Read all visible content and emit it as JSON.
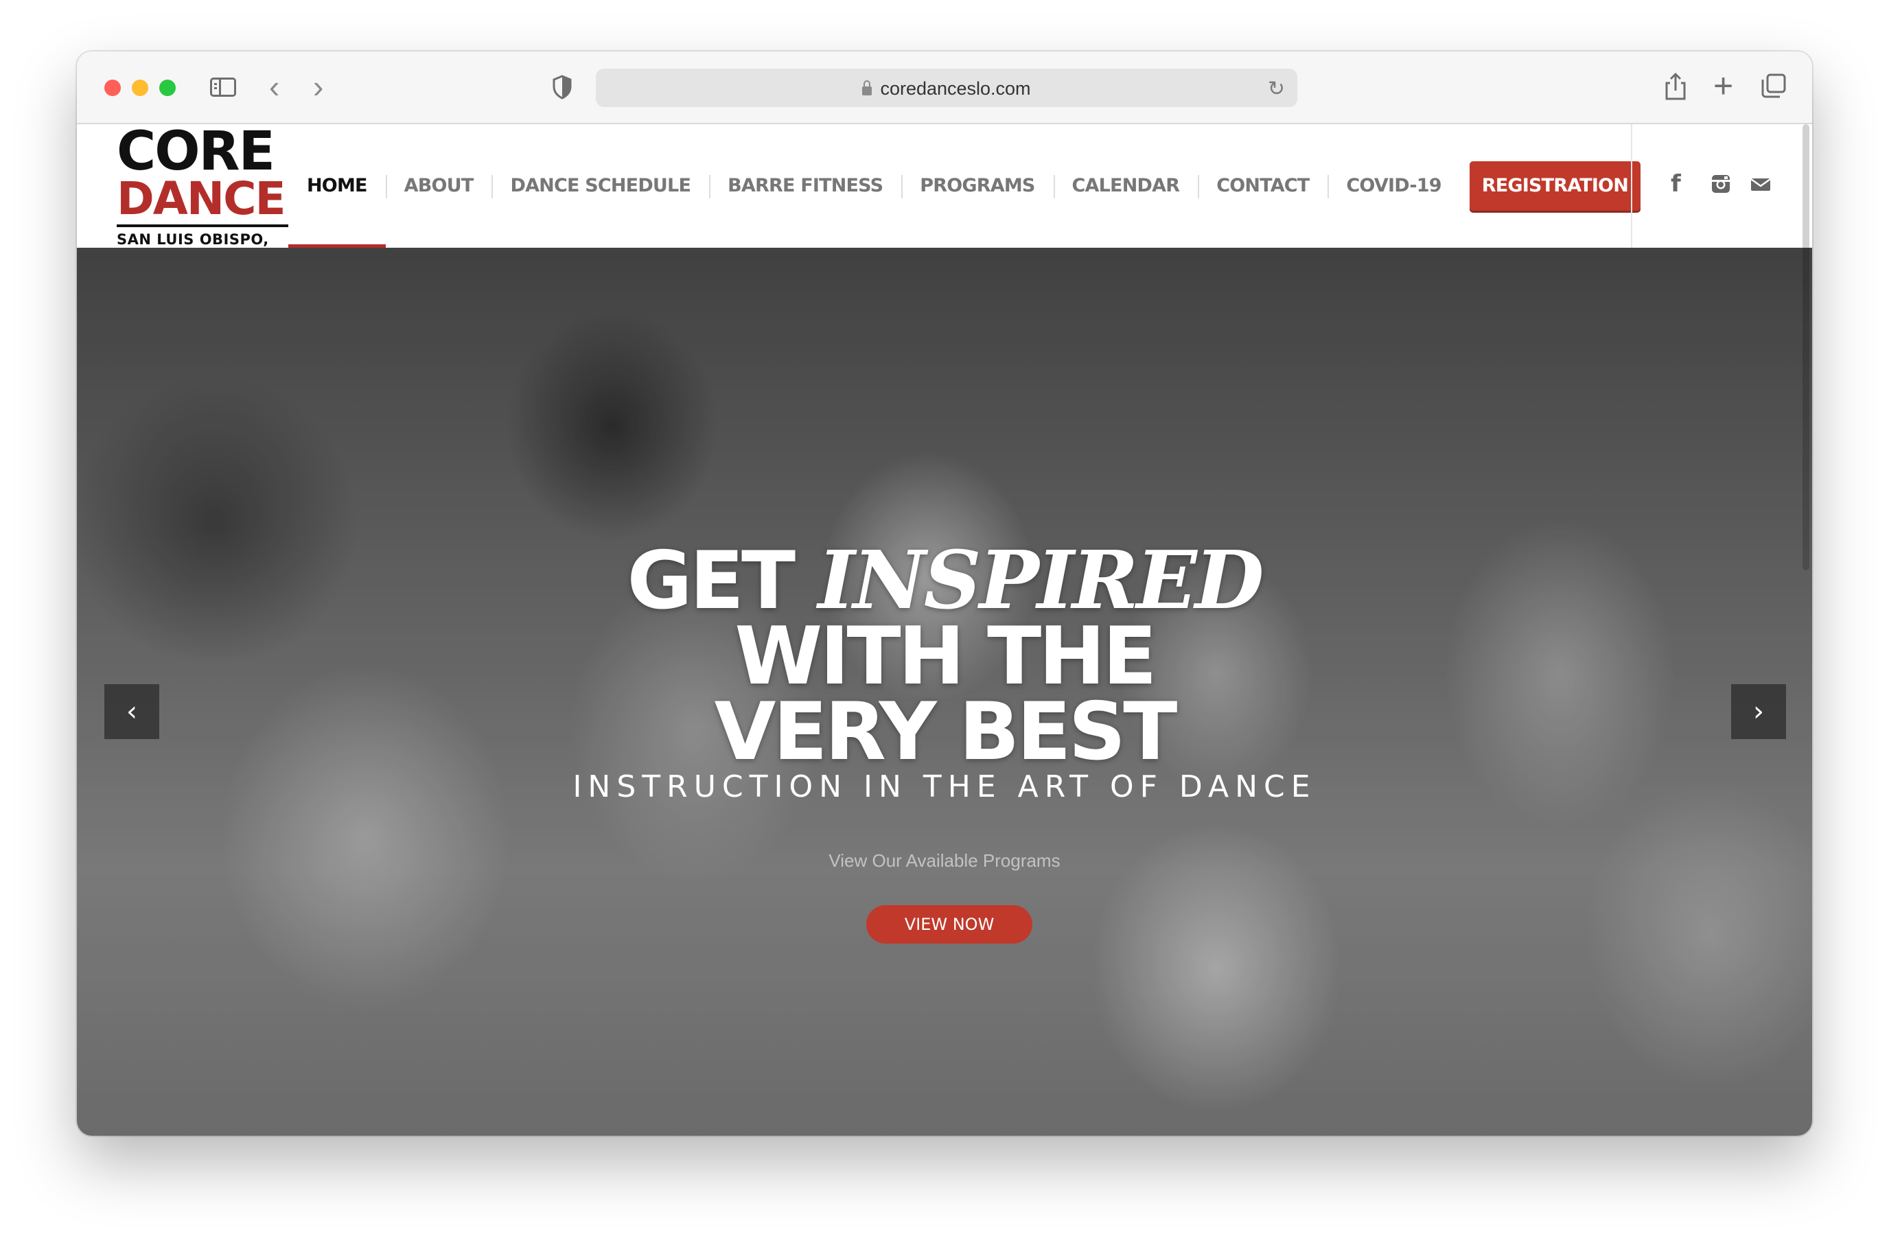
{
  "browser": {
    "url": "coredanceslo.com"
  },
  "logo": {
    "line1": "CORE",
    "line2": "DANCE",
    "location": "SAN LUIS OBISPO, CA"
  },
  "nav": {
    "items": [
      {
        "label": "HOME",
        "active": true
      },
      {
        "label": "ABOUT"
      },
      {
        "label": "DANCE SCHEDULE"
      },
      {
        "label": "BARRE FITNESS"
      },
      {
        "label": "PROGRAMS"
      },
      {
        "label": "CALENDAR"
      },
      {
        "label": "CONTACT"
      },
      {
        "label": "COVID-19"
      }
    ],
    "registration": "REGISTRATION"
  },
  "social": {
    "facebook": "f"
  },
  "hero": {
    "headline_get": "GET",
    "headline_inspired": "INSPIRED",
    "headline_line2": "WITH THE",
    "headline_line3": "VERY BEST",
    "subhead": "INSTRUCTION IN THE ART OF DANCE",
    "cta_text": "View Our Available Programs",
    "cta_button": "VIEW NOW",
    "prev_arrow": "‹",
    "next_arrow": "›"
  },
  "colors": {
    "accent": "#c0392b",
    "logo_red": "#b32e2a"
  }
}
